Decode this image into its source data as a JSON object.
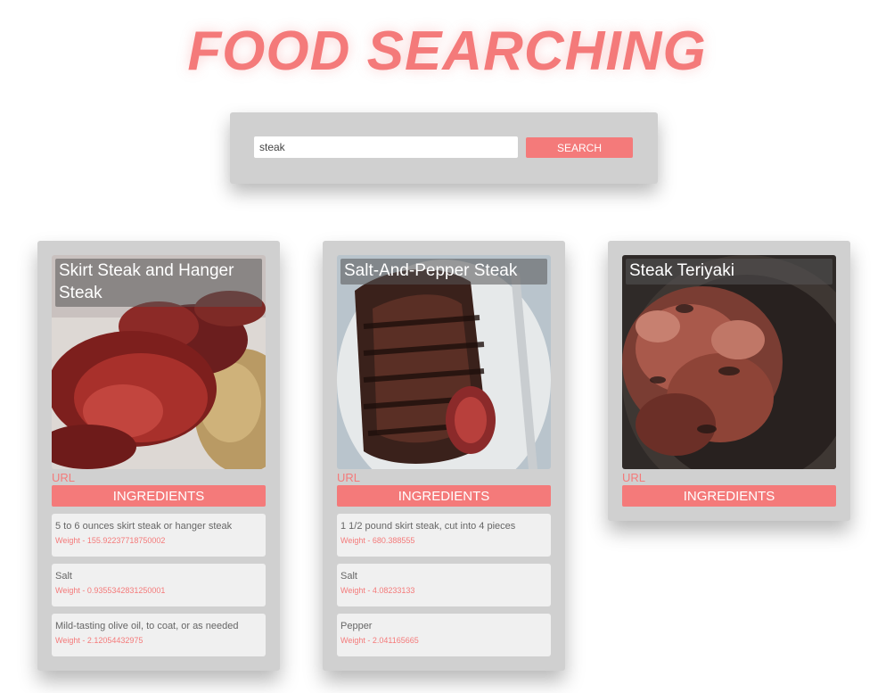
{
  "header": {
    "title": "FOOD SEARCHING"
  },
  "search": {
    "value": "steak",
    "button_label": "SEARCH"
  },
  "colors": {
    "accent": "#f47a7a",
    "panel": "#d0d0d0",
    "item_background": "#f0f0f0",
    "text_muted": "#666666"
  },
  "cards": [
    {
      "title": "Skirt Steak and Hanger Steak",
      "url_label": "URL",
      "ingredients_label": "INGREDIENTS",
      "ingredients": [
        {
          "text": "5 to 6 ounces skirt steak or hanger steak",
          "weight": "Weight - 155.92237718750002"
        },
        {
          "text": "Salt",
          "weight": "Weight - 0.9355342831250001"
        },
        {
          "text": "Mild-tasting olive oil, to coat, or as needed",
          "weight": "Weight - 2.12054432975"
        }
      ]
    },
    {
      "title": "Salt-And-Pepper Steak",
      "url_label": "URL",
      "ingredients_label": "INGREDIENTS",
      "ingredients": [
        {
          "text": "1 1/2 pound skirt steak, cut into 4 pieces",
          "weight": "Weight - 680.388555"
        },
        {
          "text": "Salt",
          "weight": "Weight - 4.08233133"
        },
        {
          "text": "Pepper",
          "weight": "Weight - 2.041165665"
        }
      ]
    },
    {
      "title": "Steak Teriyaki",
      "url_label": "URL",
      "ingredients_label": "INGREDIENTS",
      "ingredients": []
    }
  ]
}
